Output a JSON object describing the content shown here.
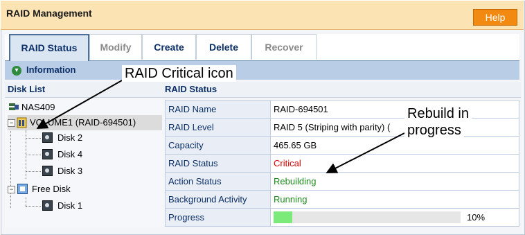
{
  "window": {
    "title": "RAID Management",
    "help_label": "Help"
  },
  "tabs": [
    {
      "label": "RAID Status",
      "state": "active"
    },
    {
      "label": "Modify",
      "state": "disabled"
    },
    {
      "label": "Create",
      "state": "enabled"
    },
    {
      "label": "Delete",
      "state": "enabled"
    },
    {
      "label": "Recover",
      "state": "disabled"
    }
  ],
  "info": {
    "label": "Information",
    "icon": "chevron-down-circle-icon"
  },
  "disk_list": {
    "header": "Disk List",
    "root": "NAS409",
    "volume": "VOLUME1 (RAID-694501)",
    "volume_disks": [
      "Disk 2",
      "Disk 4",
      "Disk 3"
    ],
    "free_disk": "Free Disk",
    "free_disks": [
      "Disk 1"
    ]
  },
  "raid_status": {
    "header": "RAID Status",
    "rows": [
      {
        "label": "RAID Name",
        "value": "RAID-694501"
      },
      {
        "label": "RAID Level",
        "value": "RAID 5 (Striping with parity) ("
      },
      {
        "label": "Capacity",
        "value": "465.65 GB"
      },
      {
        "label": "RAID Status",
        "value": "Critical"
      },
      {
        "label": "Action Status",
        "value": "Rebuilding"
      },
      {
        "label": "Background Activity",
        "value": "Running"
      }
    ],
    "progress": {
      "label": "Progress",
      "text": "10%",
      "fraction": 0.1
    }
  },
  "annotations": {
    "critical_icon": "RAID Critical icon",
    "rebuild_line1": "Rebuild in",
    "rebuild_line2": "progress"
  },
  "colors": {
    "accent": "#f28a12",
    "critical": "#e00000",
    "ok": "#1c8a1c",
    "progress_fill": "#7bea7b"
  }
}
